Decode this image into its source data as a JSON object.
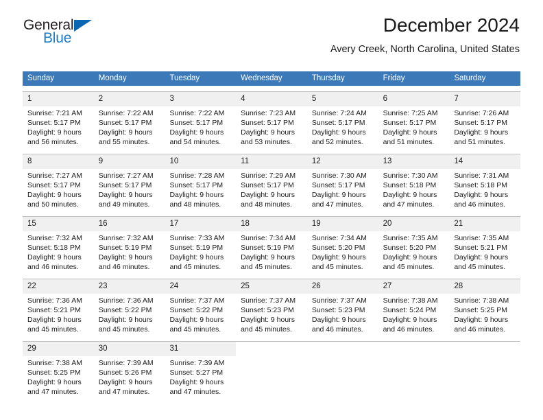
{
  "logo": {
    "word1": "General",
    "word2": "Blue",
    "triangle_color": "#0b67b2",
    "blue_color": "#1f7ac4"
  },
  "header": {
    "title": "December 2024",
    "subtitle": "Avery Creek, North Carolina, United States",
    "header_bg": "#3c79b8",
    "daynum_bg": "#f0f0f0"
  },
  "weekday_headers": [
    "Sunday",
    "Monday",
    "Tuesday",
    "Wednesday",
    "Thursday",
    "Friday",
    "Saturday"
  ],
  "weeks": [
    [
      {
        "day": "1",
        "sunrise": "Sunrise: 7:21 AM",
        "sunset": "Sunset: 5:17 PM",
        "daylight1": "Daylight: 9 hours",
        "daylight2": "and 56 minutes."
      },
      {
        "day": "2",
        "sunrise": "Sunrise: 7:22 AM",
        "sunset": "Sunset: 5:17 PM",
        "daylight1": "Daylight: 9 hours",
        "daylight2": "and 55 minutes."
      },
      {
        "day": "3",
        "sunrise": "Sunrise: 7:22 AM",
        "sunset": "Sunset: 5:17 PM",
        "daylight1": "Daylight: 9 hours",
        "daylight2": "and 54 minutes."
      },
      {
        "day": "4",
        "sunrise": "Sunrise: 7:23 AM",
        "sunset": "Sunset: 5:17 PM",
        "daylight1": "Daylight: 9 hours",
        "daylight2": "and 53 minutes."
      },
      {
        "day": "5",
        "sunrise": "Sunrise: 7:24 AM",
        "sunset": "Sunset: 5:17 PM",
        "daylight1": "Daylight: 9 hours",
        "daylight2": "and 52 minutes."
      },
      {
        "day": "6",
        "sunrise": "Sunrise: 7:25 AM",
        "sunset": "Sunset: 5:17 PM",
        "daylight1": "Daylight: 9 hours",
        "daylight2": "and 51 minutes."
      },
      {
        "day": "7",
        "sunrise": "Sunrise: 7:26 AM",
        "sunset": "Sunset: 5:17 PM",
        "daylight1": "Daylight: 9 hours",
        "daylight2": "and 51 minutes."
      }
    ],
    [
      {
        "day": "8",
        "sunrise": "Sunrise: 7:27 AM",
        "sunset": "Sunset: 5:17 PM",
        "daylight1": "Daylight: 9 hours",
        "daylight2": "and 50 minutes."
      },
      {
        "day": "9",
        "sunrise": "Sunrise: 7:27 AM",
        "sunset": "Sunset: 5:17 PM",
        "daylight1": "Daylight: 9 hours",
        "daylight2": "and 49 minutes."
      },
      {
        "day": "10",
        "sunrise": "Sunrise: 7:28 AM",
        "sunset": "Sunset: 5:17 PM",
        "daylight1": "Daylight: 9 hours",
        "daylight2": "and 48 minutes."
      },
      {
        "day": "11",
        "sunrise": "Sunrise: 7:29 AM",
        "sunset": "Sunset: 5:17 PM",
        "daylight1": "Daylight: 9 hours",
        "daylight2": "and 48 minutes."
      },
      {
        "day": "12",
        "sunrise": "Sunrise: 7:30 AM",
        "sunset": "Sunset: 5:17 PM",
        "daylight1": "Daylight: 9 hours",
        "daylight2": "and 47 minutes."
      },
      {
        "day": "13",
        "sunrise": "Sunrise: 7:30 AM",
        "sunset": "Sunset: 5:18 PM",
        "daylight1": "Daylight: 9 hours",
        "daylight2": "and 47 minutes."
      },
      {
        "day": "14",
        "sunrise": "Sunrise: 7:31 AM",
        "sunset": "Sunset: 5:18 PM",
        "daylight1": "Daylight: 9 hours",
        "daylight2": "and 46 minutes."
      }
    ],
    [
      {
        "day": "15",
        "sunrise": "Sunrise: 7:32 AM",
        "sunset": "Sunset: 5:18 PM",
        "daylight1": "Daylight: 9 hours",
        "daylight2": "and 46 minutes."
      },
      {
        "day": "16",
        "sunrise": "Sunrise: 7:32 AM",
        "sunset": "Sunset: 5:19 PM",
        "daylight1": "Daylight: 9 hours",
        "daylight2": "and 46 minutes."
      },
      {
        "day": "17",
        "sunrise": "Sunrise: 7:33 AM",
        "sunset": "Sunset: 5:19 PM",
        "daylight1": "Daylight: 9 hours",
        "daylight2": "and 45 minutes."
      },
      {
        "day": "18",
        "sunrise": "Sunrise: 7:34 AM",
        "sunset": "Sunset: 5:19 PM",
        "daylight1": "Daylight: 9 hours",
        "daylight2": "and 45 minutes."
      },
      {
        "day": "19",
        "sunrise": "Sunrise: 7:34 AM",
        "sunset": "Sunset: 5:20 PM",
        "daylight1": "Daylight: 9 hours",
        "daylight2": "and 45 minutes."
      },
      {
        "day": "20",
        "sunrise": "Sunrise: 7:35 AM",
        "sunset": "Sunset: 5:20 PM",
        "daylight1": "Daylight: 9 hours",
        "daylight2": "and 45 minutes."
      },
      {
        "day": "21",
        "sunrise": "Sunrise: 7:35 AM",
        "sunset": "Sunset: 5:21 PM",
        "daylight1": "Daylight: 9 hours",
        "daylight2": "and 45 minutes."
      }
    ],
    [
      {
        "day": "22",
        "sunrise": "Sunrise: 7:36 AM",
        "sunset": "Sunset: 5:21 PM",
        "daylight1": "Daylight: 9 hours",
        "daylight2": "and 45 minutes."
      },
      {
        "day": "23",
        "sunrise": "Sunrise: 7:36 AM",
        "sunset": "Sunset: 5:22 PM",
        "daylight1": "Daylight: 9 hours",
        "daylight2": "and 45 minutes."
      },
      {
        "day": "24",
        "sunrise": "Sunrise: 7:37 AM",
        "sunset": "Sunset: 5:22 PM",
        "daylight1": "Daylight: 9 hours",
        "daylight2": "and 45 minutes."
      },
      {
        "day": "25",
        "sunrise": "Sunrise: 7:37 AM",
        "sunset": "Sunset: 5:23 PM",
        "daylight1": "Daylight: 9 hours",
        "daylight2": "and 45 minutes."
      },
      {
        "day": "26",
        "sunrise": "Sunrise: 7:37 AM",
        "sunset": "Sunset: 5:23 PM",
        "daylight1": "Daylight: 9 hours",
        "daylight2": "and 46 minutes."
      },
      {
        "day": "27",
        "sunrise": "Sunrise: 7:38 AM",
        "sunset": "Sunset: 5:24 PM",
        "daylight1": "Daylight: 9 hours",
        "daylight2": "and 46 minutes."
      },
      {
        "day": "28",
        "sunrise": "Sunrise: 7:38 AM",
        "sunset": "Sunset: 5:25 PM",
        "daylight1": "Daylight: 9 hours",
        "daylight2": "and 46 minutes."
      }
    ],
    [
      {
        "day": "29",
        "sunrise": "Sunrise: 7:38 AM",
        "sunset": "Sunset: 5:25 PM",
        "daylight1": "Daylight: 9 hours",
        "daylight2": "and 47 minutes."
      },
      {
        "day": "30",
        "sunrise": "Sunrise: 7:39 AM",
        "sunset": "Sunset: 5:26 PM",
        "daylight1": "Daylight: 9 hours",
        "daylight2": "and 47 minutes."
      },
      {
        "day": "31",
        "sunrise": "Sunrise: 7:39 AM",
        "sunset": "Sunset: 5:27 PM",
        "daylight1": "Daylight: 9 hours",
        "daylight2": "and 47 minutes."
      },
      {
        "day": "",
        "sunrise": "",
        "sunset": "",
        "daylight1": "",
        "daylight2": ""
      },
      {
        "day": "",
        "sunrise": "",
        "sunset": "",
        "daylight1": "",
        "daylight2": ""
      },
      {
        "day": "",
        "sunrise": "",
        "sunset": "",
        "daylight1": "",
        "daylight2": ""
      },
      {
        "day": "",
        "sunrise": "",
        "sunset": "",
        "daylight1": "",
        "daylight2": ""
      }
    ]
  ]
}
